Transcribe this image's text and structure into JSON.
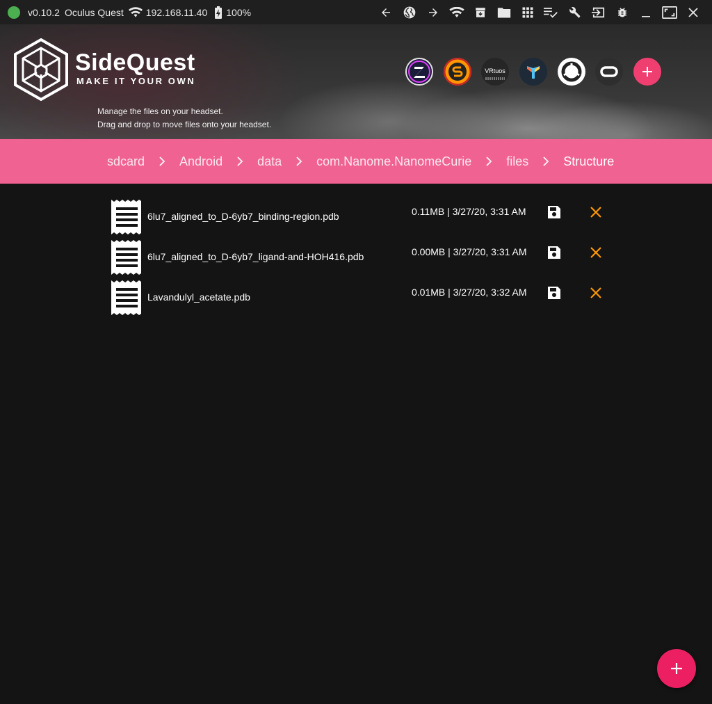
{
  "status": {
    "version": "v0.10.2",
    "device": "Oculus Quest",
    "ip": "192.168.11.40",
    "battery": "100%",
    "connected_color": "#4caf50"
  },
  "toolbar": {
    "icons": [
      "back-arrow-icon",
      "globe-icon",
      "forward-arrow-icon",
      "wifi-icon",
      "archive-icon",
      "folder-icon",
      "grid-icon",
      "playlist-check-icon",
      "wrench-icon",
      "input-icon",
      "bug-icon",
      "minimize-icon",
      "maximize-icon",
      "close-icon"
    ]
  },
  "header": {
    "brand": "SideQuest",
    "tagline": "MAKE IT YOUR OWN",
    "desc_line1": "Manage the files on your headset.",
    "desc_line2": "Drag and drop to move files onto your headset.",
    "app_icons": [
      "zeoni-icon",
      "sidequest-s-icon",
      "vrtuos-icon",
      "trident-icon",
      "ring-icon",
      "oculus-icon"
    ],
    "app_icon_vrtuos_label": "VRtuos",
    "accent": "#ee3f70"
  },
  "breadcrumb": {
    "items": [
      "sdcard",
      "Android",
      "data",
      "com.Nanome.NanomeCurie",
      "files",
      "Structure"
    ],
    "bar_color": "#f06292"
  },
  "files": [
    {
      "name": "6lu7_aligned_to_D-6yb7_binding-region.pdb",
      "meta": "0.11MB | 3/27/20, 3:31 AM"
    },
    {
      "name": "6lu7_aligned_to_D-6yb7_ligand-and-HOH416.pdb",
      "meta": "0.00MB | 3/27/20, 3:31 AM"
    },
    {
      "name": "Lavandulyl_acetate.pdb",
      "meta": "0.01MB | 3/27/20, 3:32 AM"
    }
  ],
  "colors": {
    "delete": "#ff9800",
    "fab": "#ec1f63"
  }
}
